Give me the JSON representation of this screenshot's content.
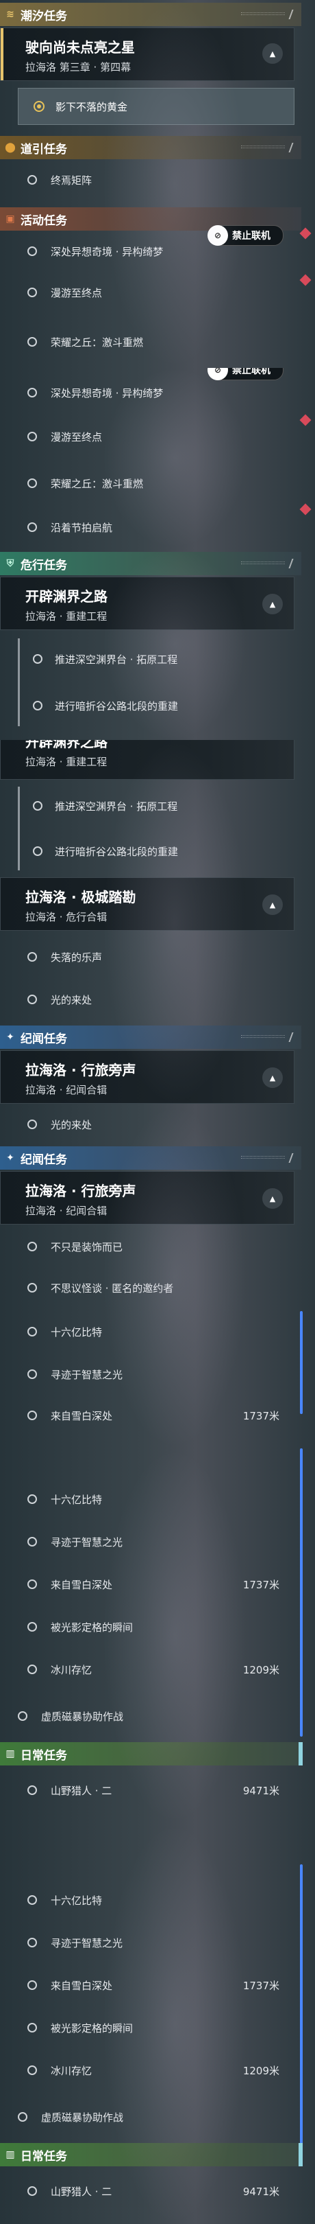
{
  "panel1": {
    "tide_header": "潮汐任务",
    "tide_card_title": "驶向尚未点亮之星",
    "tide_card_subtitle": "拉海洛 第三章 · 第四幕",
    "tide_selected": "影下不落的黄金",
    "guide_header": "道引任务",
    "guide_item": "终焉矩阵",
    "event_header": "活动任务",
    "event_items": [
      "深处异想奇境 · 异构绮梦",
      "漫游至终点",
      "荣耀之丘：激斗重燃"
    ],
    "badge_label": "禁止联机"
  },
  "panel2": {
    "badge_label": "禁止联机",
    "items": [
      "深处异想奇境 · 异构绮梦",
      "漫游至终点",
      "荣耀之丘：激斗重燃",
      "沿着节拍启航"
    ]
  },
  "panel3": {
    "danger_header": "危行任务",
    "card_title": "开辟渊界之路",
    "card_subtitle": "拉海洛 · 重建工程",
    "items": [
      "推进深空渊界台 · 拓原工程",
      "进行暗折谷公路北段的重建"
    ]
  },
  "panel4": {
    "card_title": "开辟渊界之路",
    "card_subtitle": "拉海洛 · 重建工程",
    "items": [
      "推进深空渊界台 · 拓原工程",
      "进行暗折谷公路北段的重建"
    ],
    "card2_title": "拉海洛 · 极城踏勘",
    "card2_subtitle": "拉海洛 · 危行合辑",
    "items2": [
      "失落的乐声",
      "光的来处"
    ],
    "lore_header": "纪闻任务",
    "card3_title": "拉海洛 · 行旅旁声",
    "card3_subtitle": "拉海洛 · 纪闻合辑"
  },
  "panel5": {
    "item": "光的来处",
    "lore_header": "纪闻任务",
    "card_title": "拉海洛 · 行旅旁声",
    "card_subtitle": "拉海洛 · 纪闻合辑",
    "items": [
      {
        "label": "不只是装饰而已",
        "dist": ""
      },
      {
        "label": "不思议怪谈 · 匿名的邀约者",
        "dist": ""
      },
      {
        "label": "十六亿比特",
        "dist": ""
      },
      {
        "label": "寻迹于智慧之光",
        "dist": ""
      },
      {
        "label": "来自雪白深处",
        "dist": "1737米"
      }
    ]
  },
  "panel6": {
    "items": [
      {
        "label": "十六亿比特",
        "dist": ""
      },
      {
        "label": "寻迹于智慧之光",
        "dist": ""
      },
      {
        "label": "来自雪白深处",
        "dist": "1737米"
      },
      {
        "label": "被光影定格的瞬间",
        "dist": ""
      },
      {
        "label": "冰川存忆",
        "dist": "1209米"
      },
      {
        "label": "虚质磁暴协助作战",
        "dist": ""
      }
    ],
    "daily_header": "日常任务",
    "daily_item": {
      "label": "山野猎人 · 二",
      "dist": "9471米"
    }
  },
  "panel7": {
    "items": [
      {
        "label": "十六亿比特",
        "dist": ""
      },
      {
        "label": "寻迹于智慧之光",
        "dist": ""
      },
      {
        "label": "来自雪白深处",
        "dist": "1737米"
      },
      {
        "label": "被光影定格的瞬间",
        "dist": ""
      },
      {
        "label": "冰川存忆",
        "dist": "1209米"
      },
      {
        "label": "虚质磁暴协助作战",
        "dist": ""
      }
    ],
    "daily_header": "日常任务",
    "daily_item": {
      "label": "山野猎人 · 二",
      "dist": "9471米"
    }
  },
  "colors": {
    "tide": "#e6c36b",
    "guide": "#e0a23c",
    "event": "#e07a4a",
    "danger": "#43b58f",
    "lore": "#3a8ee6",
    "daily": "#4fa94a",
    "alert": "#d84a5a",
    "scroll": "#4a87ff"
  },
  "icons": {
    "tide": "wave-icon",
    "guide": "location-pin-icon",
    "event": "gamepad-icon",
    "danger": "shield-icon",
    "lore": "star-icon",
    "daily": "calendar-icon",
    "badge": "no-coop-icon"
  }
}
